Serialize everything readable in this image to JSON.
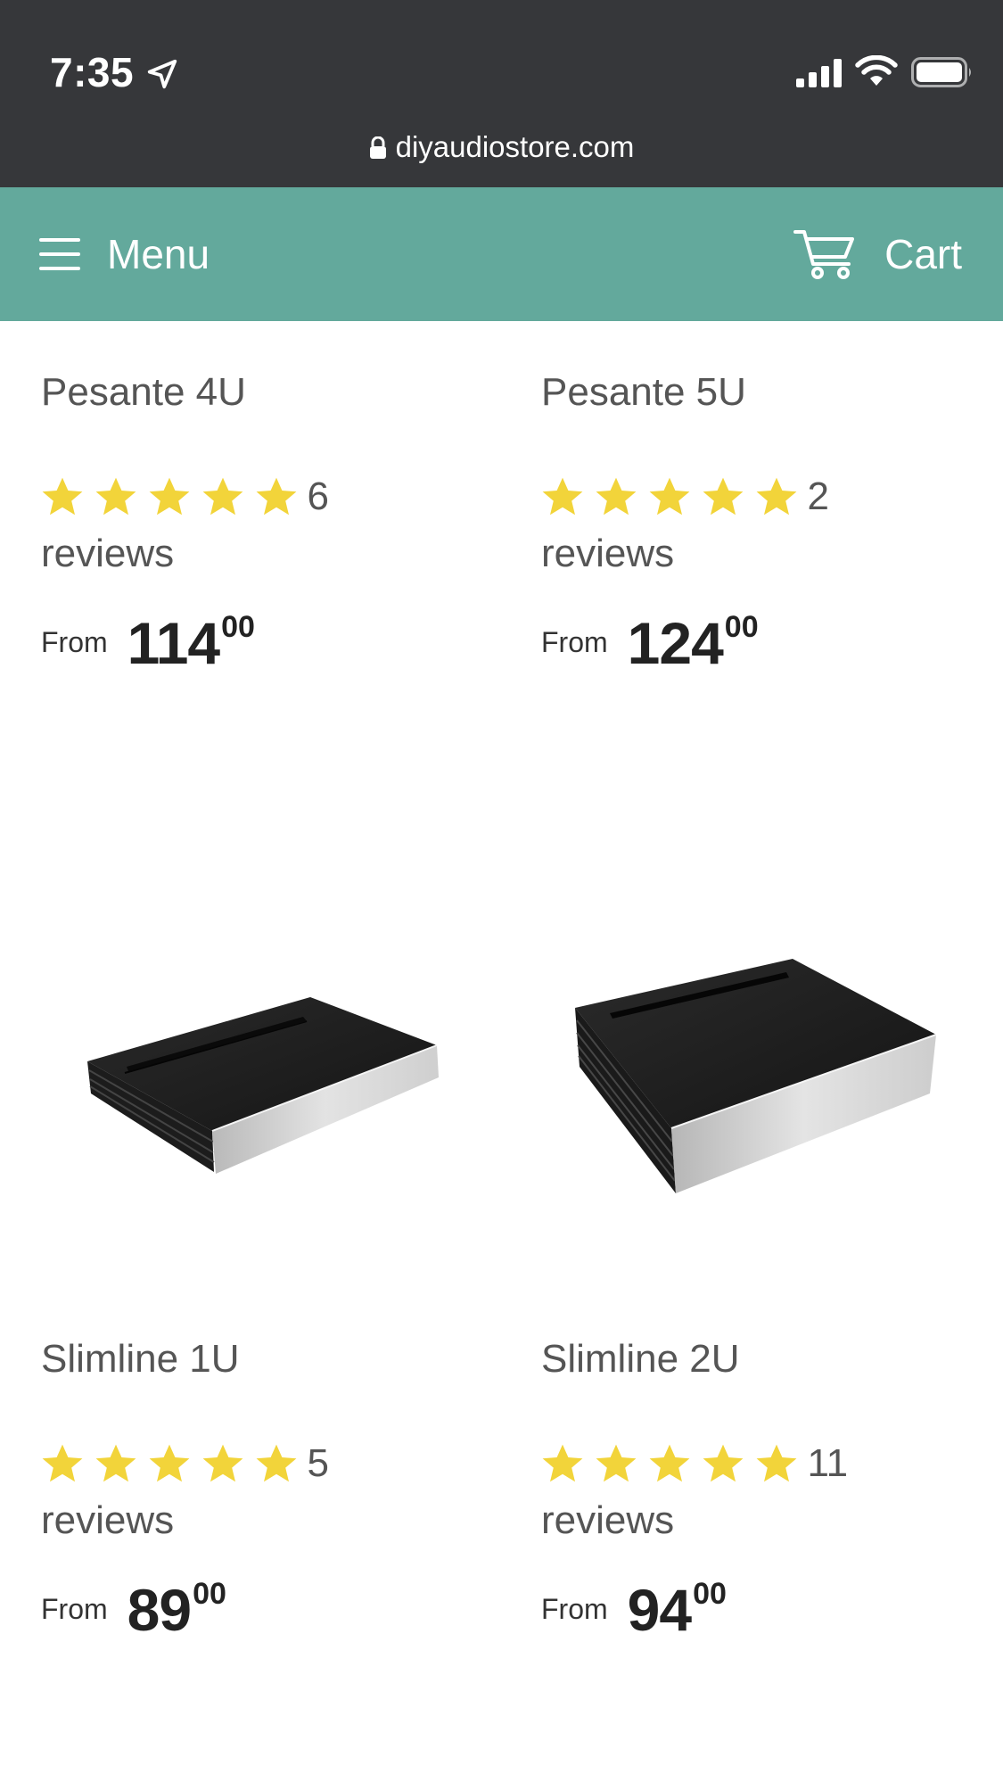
{
  "status_bar": {
    "time": "7:35",
    "icons": [
      "location-arrow-icon",
      "cellular-signal-icon",
      "wifi-icon",
      "battery-icon"
    ]
  },
  "url_bar": {
    "domain": "diyaudiostore.com",
    "icon": "lock-icon"
  },
  "header": {
    "menu_label": "Menu",
    "menu_icon": "hamburger-icon",
    "cart_label": "Cart",
    "cart_icon": "cart-icon",
    "background_color": "#63a99c"
  },
  "colors": {
    "chrome_background": "#36373a",
    "star": "#f2d43a",
    "text": "#555555",
    "price": "#222222"
  },
  "products": [
    {
      "title": "Pesante 4U",
      "rating": 5,
      "review_count": "6",
      "review_word": "reviews",
      "price_prefix": "From",
      "price_main": "114",
      "price_cents": "00"
    },
    {
      "title": "Pesante 5U",
      "rating": 5,
      "review_count": "2",
      "review_word": "reviews",
      "price_prefix": "From",
      "price_main": "124",
      "price_cents": "00"
    },
    {
      "title": "Slimline 1U",
      "rating": 5,
      "review_count": "5",
      "review_word": "reviews",
      "price_prefix": "From",
      "price_main": "89",
      "price_cents": "00"
    },
    {
      "title": "Slimline 2U",
      "rating": 5,
      "review_count": "11",
      "review_word": "reviews",
      "price_prefix": "From",
      "price_main": "94",
      "price_cents": "00"
    }
  ]
}
